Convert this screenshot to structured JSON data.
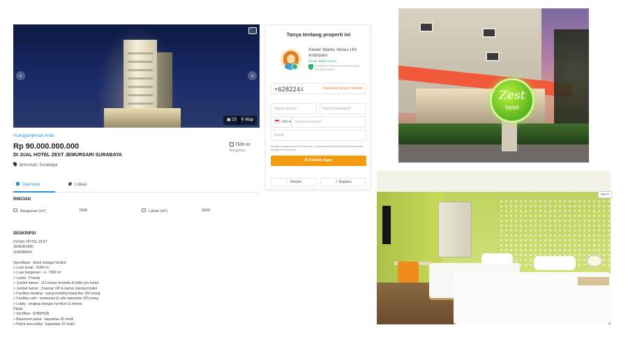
{
  "listing": {
    "hero": {
      "photo_count": "23",
      "map_label": "Map"
    },
    "lead_text": "#Langganjeman Anda",
    "price": "Rp 90.000.000.000",
    "title": "DI JUAL HOTEL ZEST JEMURSARI SURABAYA",
    "location": "Jemursari, Surabaya",
    "area_value": "7500 m²",
    "area_label": "Bangunan",
    "tabs": [
      {
        "label": "Overview",
        "active": true
      },
      {
        "label": "Lokasi",
        "active": false
      }
    ],
    "rincian_heading": "RINCIAN",
    "specs": [
      {
        "label": "Bangunan (m²)",
        "value": "7000"
      },
      {
        "label": "Lahan (m²)",
        "value": "5000"
      }
    ],
    "deskripsi_heading": "DESKRIPSI",
    "description_lines": [
      "DIJUAL HOTEL ZEST",
      "JEMURSARI",
      "SURABAYA",
      "",
      "Spesifikasi          : detail sebagai berikut:",
      "> Luas tanah         : 5000 m²",
      "> Luas bangunan      : +/- 7000 m²",
      "> Lantai             : 9 lantai",
      "> Jumlah kamar       : 111 kamar tersedia & lobby per lantai",
      "> Jumlah kamar       : 3 kamar VIP & kamar standard toilet",
      "> Fasilitas meeting  : ruang meeting kapasitas 150 orang",
      "> Fasilitas cafe     : restaurant & cafe kapasitas 100 orang",
      "> Lobby              : lengkap dengan furniture & interior",
      "Harga",
      "> Sertifikat         : SHM/HGB",
      "> Basement parkir    : kapasitas 25 mobil",
      "> Parkir area lobby  : kapasitas 20 mobil"
    ]
  },
  "contact_card": {
    "title": "Tanya tentang properti ini",
    "agent_name": "Xavier Marks Venus UH Andriyani",
    "agent_role": "Xavier Marks Venus",
    "agent_verified": "TERVERIFIKASI OLEH AGEN DARI XAVIER MARKS",
    "phone_partial": "+6282244",
    "show_number_label": "Tunjukkan Nomor Telepon",
    "first_name_placeholder": "Nama depan*",
    "last_name_placeholder": "Nama belakang*",
    "country_code": "+62",
    "phone_placeholder": "Nomor telepon*",
    "email_placeholder": "Email",
    "consent_text": "Dengan mengklik tombol 'Kontak Agen', Anda menyetujui Syarat & Ketentuan serta Kebijakan Privasi kami.",
    "contact_button": "Kontak Agen",
    "save_button": "Simpan",
    "share_button": "Bagikan"
  },
  "gallery": {
    "exterior_sign_main": "Zest",
    "exterior_sign_sub": "hotel",
    "next_label": "NEXT"
  },
  "colors": {
    "accent_blue": "#2a8fd8",
    "accent_orange": "#f39c12",
    "verified_green": "#2bb673"
  }
}
